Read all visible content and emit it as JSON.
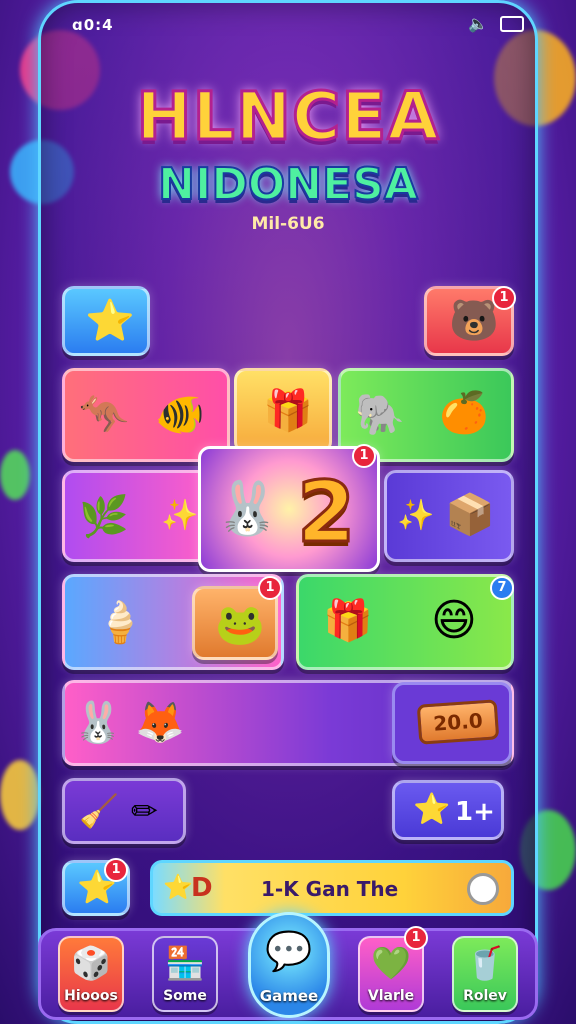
{
  "status_bar": {
    "time": "ɑ0:4",
    "sound_icon": "speaker-icon",
    "battery_icon": "battery-icon"
  },
  "title": {
    "line1": "HLNCEA",
    "line2": "NIDONESA",
    "subtitle": "Mil-6U6"
  },
  "grid": {
    "badge_top_right": "1",
    "badge_center": "1",
    "center_number": "2",
    "badge_frame": "1",
    "badge_blue": "7",
    "price_tag": "20.0",
    "plus_button": "1+"
  },
  "progress_bar": {
    "badge": "1",
    "label_D": "D",
    "label": "1-K Gan The"
  },
  "nav": {
    "items": [
      {
        "label": "Hiooos",
        "icon": "dice-icon"
      },
      {
        "label": "Some",
        "icon": "shop-icon"
      },
      {
        "label": "Gamee",
        "icon": "chat-bubble-icon"
      },
      {
        "label": "Vlarle",
        "icon": "heart-icon",
        "badge": "1"
      },
      {
        "label": "Rolev",
        "icon": "cup-icon"
      }
    ]
  },
  "colors": {
    "accent": "#5fd6ff",
    "gold": "#ffd23a",
    "badge_red": "#e8253c"
  }
}
